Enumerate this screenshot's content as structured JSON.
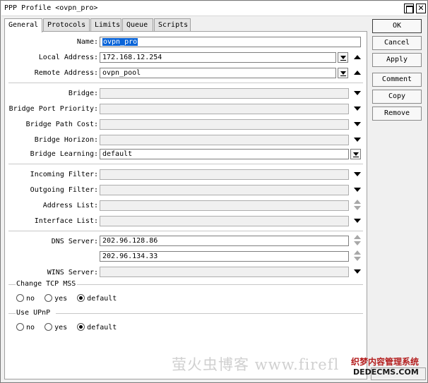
{
  "window": {
    "title": "PPP Profile <ovpn_pro>",
    "restore_label": "",
    "close_label": "✕"
  },
  "tabs": [
    {
      "label": "General",
      "active": true
    },
    {
      "label": "Protocols"
    },
    {
      "label": "Limits"
    },
    {
      "label": "Queue"
    },
    {
      "label": "Scripts"
    }
  ],
  "form": {
    "name": {
      "label": "Name:",
      "value": "ovpn_pro"
    },
    "local_address": {
      "label": "Local Address:",
      "value": "172.168.12.254"
    },
    "remote_address": {
      "label": "Remote Address:",
      "value": "ovpn_pool"
    },
    "bridge": {
      "label": "Bridge:",
      "value": ""
    },
    "bridge_port_priority": {
      "label": "Bridge Port Priority:",
      "value": ""
    },
    "bridge_path_cost": {
      "label": "Bridge Path Cost:",
      "value": ""
    },
    "bridge_horizon": {
      "label": "Bridge Horizon:",
      "value": ""
    },
    "bridge_learning": {
      "label": "Bridge Learning:",
      "value": "default"
    },
    "incoming_filter": {
      "label": "Incoming Filter:",
      "value": ""
    },
    "outgoing_filter": {
      "label": "Outgoing Filter:",
      "value": ""
    },
    "address_list": {
      "label": "Address List:",
      "value": ""
    },
    "interface_list": {
      "label": "Interface List:",
      "value": ""
    },
    "dns_server": {
      "label": "DNS Server:",
      "values": [
        "202.96.128.86",
        "202.96.134.33"
      ]
    },
    "wins_server": {
      "label": "WINS Server:",
      "value": ""
    },
    "change_tcp_mss": {
      "label": "Change TCP MSS",
      "options": [
        "no",
        "yes",
        "default"
      ],
      "selected": "default"
    },
    "use_upnp": {
      "label": "Use UPnP",
      "options": [
        "no",
        "yes",
        "default"
      ],
      "selected": "default"
    }
  },
  "buttons": {
    "ok": "OK",
    "cancel": "Cancel",
    "apply": "Apply",
    "comment": "Comment",
    "copy": "Copy",
    "remove": "Remove"
  },
  "watermark": {
    "text1": "萤火虫博客 www.firefl",
    "text2a": "织梦内容管理系统",
    "text2b": "DEDECMS.COM"
  }
}
